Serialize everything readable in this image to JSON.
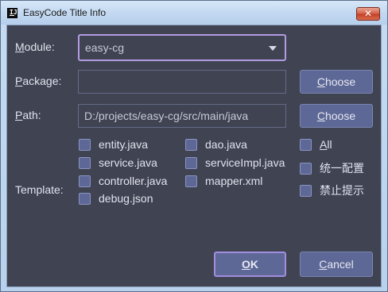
{
  "window": {
    "title": "EasyCode Title Info",
    "close_glyph": "✕",
    "app_icon_text": "IJ"
  },
  "module": {
    "label_mnemonic": "M",
    "label_rest": "odule:",
    "value": "easy-cg"
  },
  "package": {
    "label_mnemonic": "P",
    "label_rest": "ackage:",
    "value": "",
    "button_mnemonic": "C",
    "button_rest": "hoose"
  },
  "path": {
    "label_mnemonic": "P",
    "label_rest": "ath:",
    "value": "D:/projects/easy-cg/src/main/java",
    "button_mnemonic": "C",
    "button_rest": "hoose"
  },
  "template": {
    "label": "Template:",
    "items": [
      {
        "label": "entity.java",
        "checked": false
      },
      {
        "label": "service.java",
        "checked": false
      },
      {
        "label": "controller.java",
        "checked": false
      },
      {
        "label": "debug.json",
        "checked": false
      },
      {
        "label": "dao.java",
        "checked": false
      },
      {
        "label": "serviceImpl.java",
        "checked": false
      },
      {
        "label": "mapper.xml",
        "checked": false
      }
    ],
    "options": [
      {
        "label_mnemonic": "A",
        "label_rest": "ll",
        "checked": false
      },
      {
        "label": "统一配置",
        "checked": false
      },
      {
        "label": "禁止提示",
        "checked": false
      }
    ]
  },
  "footer": {
    "ok_mnemonic": "O",
    "ok_rest": "K",
    "cancel_mnemonic": "C",
    "cancel_rest": "ancel"
  },
  "colors": {
    "background": "#3f4352",
    "button": "#5d6896",
    "focus_border": "#b49be3",
    "text": "#e1e4ee"
  }
}
